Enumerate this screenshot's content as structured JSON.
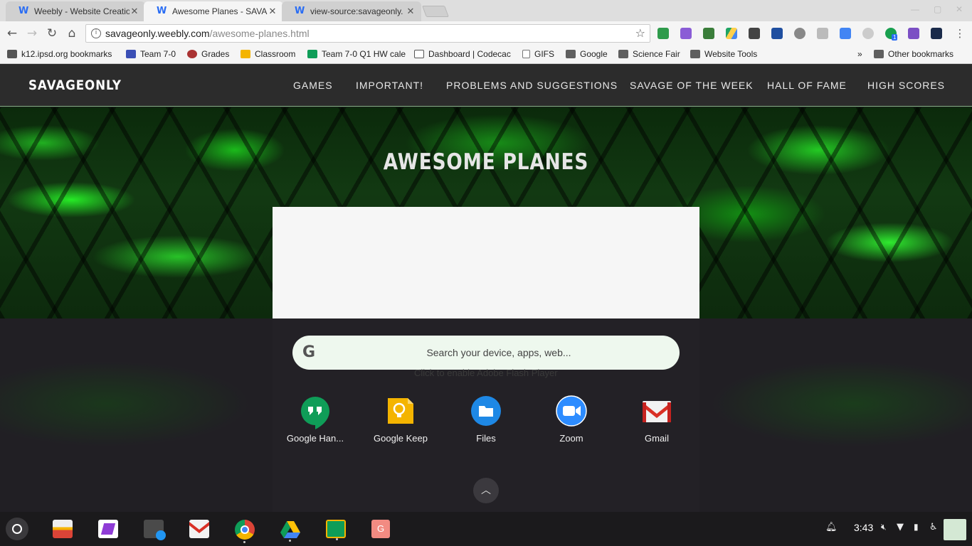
{
  "browser": {
    "tabs": [
      {
        "title": "Weebly - Website Creatio",
        "active": false
      },
      {
        "title": "Awesome Planes - SAVA",
        "active": true
      },
      {
        "title": "view-source:savageonly.",
        "active": false
      }
    ],
    "url_host": "savageonly.weebly.com",
    "url_path": "/awesome-planes.html",
    "bookmarks": [
      {
        "label": "k12.ipsd.org bookmarks",
        "icon": "apps-grid-icon"
      },
      {
        "label": "Team 7-0",
        "icon": "calendar-icon"
      },
      {
        "label": "Grades",
        "icon": "grades-icon"
      },
      {
        "label": "Classroom",
        "icon": "classroom-icon"
      },
      {
        "label": "Team 7-0 Q1 HW cale",
        "icon": "sheets-icon"
      },
      {
        "label": "Dashboard | Codecac",
        "icon": "codecademy-icon"
      },
      {
        "label": "GIFS",
        "icon": "page-icon"
      },
      {
        "label": "Google",
        "icon": "folder-icon"
      },
      {
        "label": "Science Fair",
        "icon": "folder-icon"
      },
      {
        "label": "Website Tools",
        "icon": "folder-icon"
      }
    ],
    "bookmarks_overflow": "»",
    "other_bookmarks": "Other bookmarks",
    "extension_badge": "1"
  },
  "site": {
    "logo": "SAVAGEONLY",
    "nav": [
      "GAMES",
      "IMPORTANT!",
      "PROBLEMS AND SUGGESTIONS",
      "SAVAGE OF THE WEEK",
      "HALL OF FAME",
      "HIGH SCORES"
    ],
    "page_title": "AWESOME PLANES",
    "faded_text": "Click to enable Adobe Flash Player"
  },
  "launcher": {
    "search_placeholder": "Search your device, apps, web...",
    "apps": [
      {
        "label": "Google Han...",
        "icon": "hangouts-icon"
      },
      {
        "label": "Google Keep",
        "icon": "keep-icon"
      },
      {
        "label": "Files",
        "icon": "files-icon"
      },
      {
        "label": "Zoom",
        "icon": "zoom-icon"
      },
      {
        "label": "Gmail",
        "icon": "gmail-icon"
      }
    ]
  },
  "shelf": {
    "apps": [
      "chrome-canary-icon",
      "slides-icon",
      "calculator-icon",
      "gmail-icon",
      "chrome-icon",
      "drive-icon",
      "classroom-icon",
      "g-app-icon"
    ],
    "g_app_letter": "G",
    "time": "3:43"
  },
  "colors": {
    "accent_green": "#2bff2b",
    "header_bg": "#2c2c2c",
    "launcher_bg": "#232126"
  }
}
